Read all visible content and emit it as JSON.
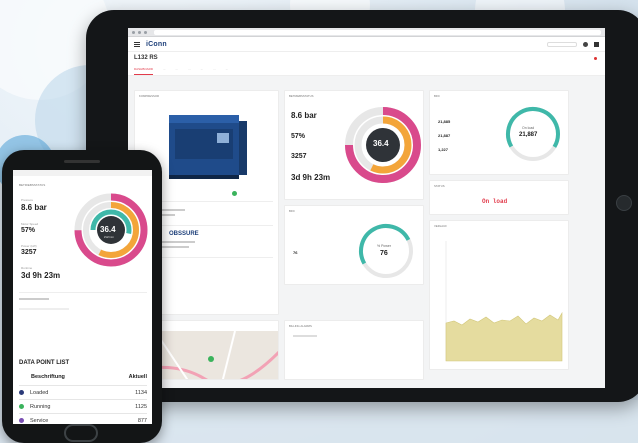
{
  "colors": {
    "pink": "#d94a8c",
    "orange": "#f3a53a",
    "teal": "#3fb8a9",
    "track": "#e7e7e7",
    "center": "#2f3338",
    "red": "#e23b4b",
    "status_green": "#3ab35c",
    "chart_fill": "#e5dc9f"
  },
  "tablet": {
    "logo": "iConn",
    "device_name": "L132 RS",
    "tabs": [
      "DASHBOARD",
      "...",
      "...",
      "...",
      "...",
      "...",
      "..."
    ],
    "cards": {
      "kompressor": "KOMPRESSOR",
      "betriebsstatus": "BETRIEBSSTATUS",
      "bfd": "BFD",
      "status": "STATUS",
      "bfd2": "BFD",
      "verlauf": "VERLAUF",
      "location": "LOCATION",
      "alarms": "BILLING ALARMS"
    },
    "gauge": {
      "pressure": "8.6 bar",
      "speed": "57%",
      "flow": "3257",
      "runtime": "3d 9h 23m",
      "center_value": "36.4",
      "center_unit": "kW"
    },
    "bfd": {
      "stat1_value": "21,885",
      "stat2_value": "21,887",
      "stat3_value": "1,227",
      "ring_label": "On load",
      "ring_value": "21,887"
    },
    "status_text": "On load",
    "bfd2": {
      "left_value": "76",
      "ring_label": "% Power",
      "ring_value": "76"
    },
    "company": "OBSSURE"
  },
  "phone": {
    "card_title": "BETRIEBSSTATUS",
    "gauge": {
      "label1": "Pressure",
      "pressure": "8.6 bar",
      "label2": "Motor Speed",
      "speed": "57%",
      "label3": "Power (kW)",
      "flow": "3257",
      "label4": "Runtime",
      "runtime": "3d 9h 23m",
      "center_value": "36.4",
      "center_unit": "kW/min"
    },
    "list_title": "DATA POINT LIST",
    "col_name": "Beschriftung",
    "col_value": "Aktuell",
    "rows": [
      {
        "label": "Loaded",
        "value": "1134",
        "color": "#2a3a78"
      },
      {
        "label": "Running",
        "value": "1125",
        "color": "#3ab35c"
      },
      {
        "label": "Service",
        "value": "877",
        "color": "#7a4fb3"
      }
    ]
  }
}
